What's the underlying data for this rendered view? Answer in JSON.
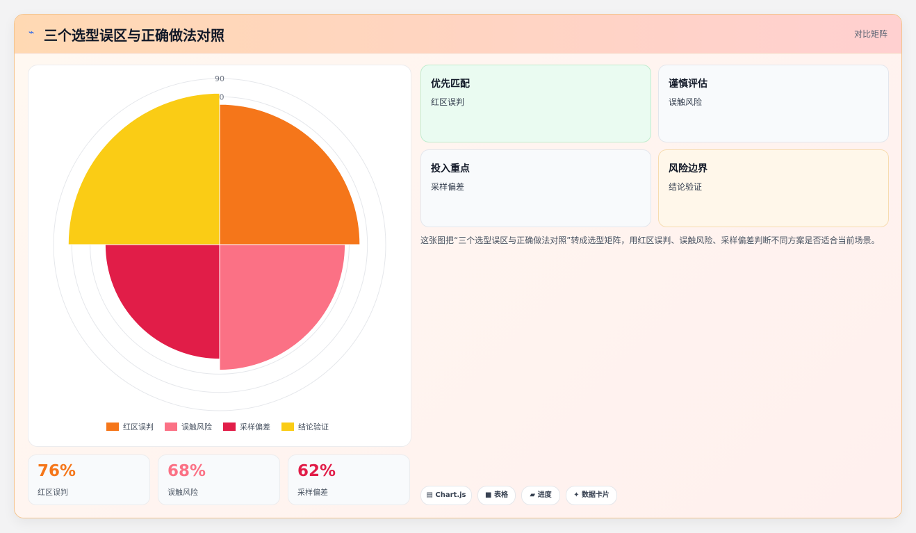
{
  "header": {
    "icon": "bolt-icon",
    "title": "三个选型误区与正确做法对照",
    "badge": "对比矩阵"
  },
  "chart_data": {
    "type": "polarArea",
    "categories": [
      "红区误判",
      "误触风险",
      "采样偏差",
      "结论验证"
    ],
    "values": [
      76,
      68,
      62,
      82
    ],
    "colors": [
      "#f5761a",
      "#fb7185",
      "#e11d48",
      "#facc15"
    ],
    "r_ticks": [
      "90",
      "0"
    ],
    "r_max": 90,
    "legend": [
      "红区误判",
      "误触风险",
      "采样偏差",
      "结论验证"
    ],
    "legend_position": "bottom",
    "grid": true
  },
  "stats": [
    {
      "value": "76%",
      "label": "红区误判",
      "color": "#f5761a"
    },
    {
      "value": "68%",
      "label": "误触风险",
      "color": "#fb7185"
    },
    {
      "value": "62%",
      "label": "采样偏差",
      "color": "#e11d48"
    }
  ],
  "tiles": [
    {
      "title": "优先匹配",
      "text": "红区误判",
      "bg": "#eafbf1",
      "border": "#bfeccd"
    },
    {
      "title": "谨慎评估",
      "text": "误触风险",
      "bg": "#f8fafc",
      "border": "#e3e6ec"
    },
    {
      "title": "投入重点",
      "text": "采样偏差",
      "bg": "#f8fafc",
      "border": "#e3e6ec"
    },
    {
      "title": "风险边界",
      "text": "结论验证",
      "bg": "#fff7ea",
      "border": "#f7dcb0"
    }
  ],
  "description": "这张图把“三个选型误区与正确做法对照”转成选型矩阵，用红区误判、误触风险、采样偏差判断不同方案是否适合当前场景。",
  "chips": [
    {
      "icon": "chart-icon",
      "glyph": "▤",
      "label": "Chart.js"
    },
    {
      "icon": "table-icon",
      "glyph": "■",
      "label": "表格"
    },
    {
      "icon": "progress-icon",
      "glyph": "▰",
      "label": "进度"
    },
    {
      "icon": "sparkle-icon",
      "glyph": "✦",
      "label": "数据卡片"
    }
  ]
}
